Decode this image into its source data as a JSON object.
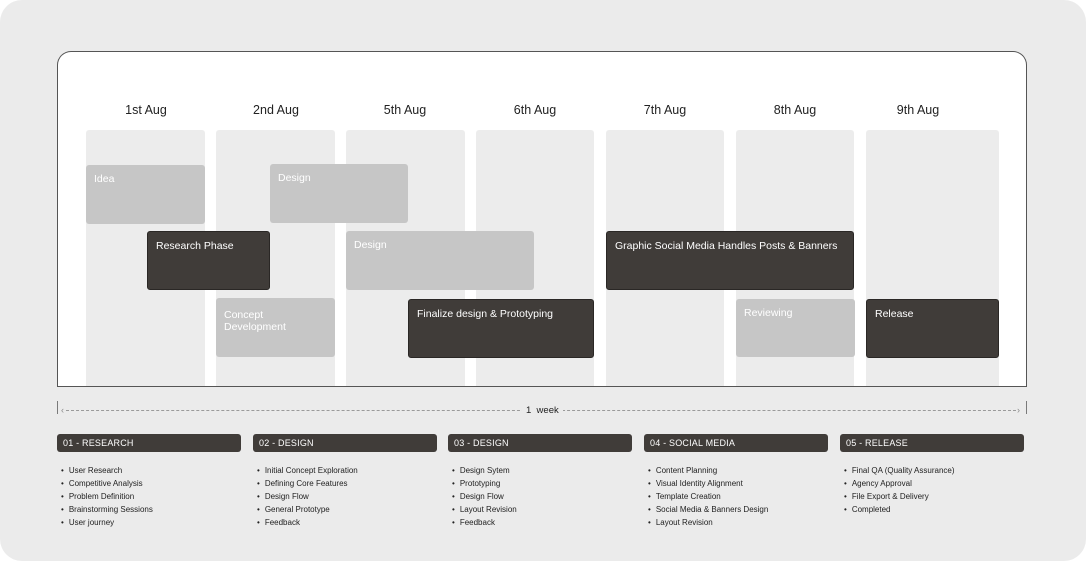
{
  "days": [
    "1st Aug",
    "2nd Aug",
    "5th Aug",
    "6th Aug",
    "7th Aug",
    "8th Aug",
    "9th Aug"
  ],
  "tasks": [
    {
      "label": "Idea",
      "style": "light"
    },
    {
      "label": "Design",
      "style": "light"
    },
    {
      "label": "Research Phase",
      "style": "dark"
    },
    {
      "label": "Design",
      "style": "light"
    },
    {
      "label": "Graphic Social Media Handles Posts & Banners",
      "style": "dark"
    },
    {
      "label": "Concept\nDevelopment",
      "style": "light"
    },
    {
      "label": "Finalize design & Prototyping",
      "style": "dark"
    },
    {
      "label": "Reviewing",
      "style": "light"
    },
    {
      "label": "Release",
      "style": "dark"
    }
  ],
  "timeline": {
    "label": "1  week"
  },
  "phases": [
    {
      "title": "01 - RESEARCH",
      "items": [
        "User Research",
        "Competitive Analysis",
        "Problem Definition",
        "Brainstorming Sessions",
        "User journey"
      ]
    },
    {
      "title": "02 - DESIGN",
      "items": [
        "Initial Concept Exploration",
        "Defining Core Features",
        "Design Flow",
        "General Prototype",
        "Feedback"
      ]
    },
    {
      "title": "03 - DESIGN",
      "items": [
        "Design Sytem",
        "Prototyping",
        "Design Flow",
        "Layout Revision",
        "Feedback"
      ]
    },
    {
      "title": "04 - SOCIAL MEDIA",
      "items": [
        "Content Planning",
        "Visual Identity Alignment",
        "Template Creation",
        "Social Media & Banners Design",
        "Layout Revision"
      ]
    },
    {
      "title": "05 - RELEASE",
      "items": [
        "Final QA (Quality Assurance)",
        "Agency Approval",
        "File Export & Delivery",
        "Completed"
      ]
    }
  ],
  "colors": {
    "dark": "#403c39",
    "light": "#c6c6c6",
    "column": "#ececec",
    "background": "#ebebeb"
  }
}
